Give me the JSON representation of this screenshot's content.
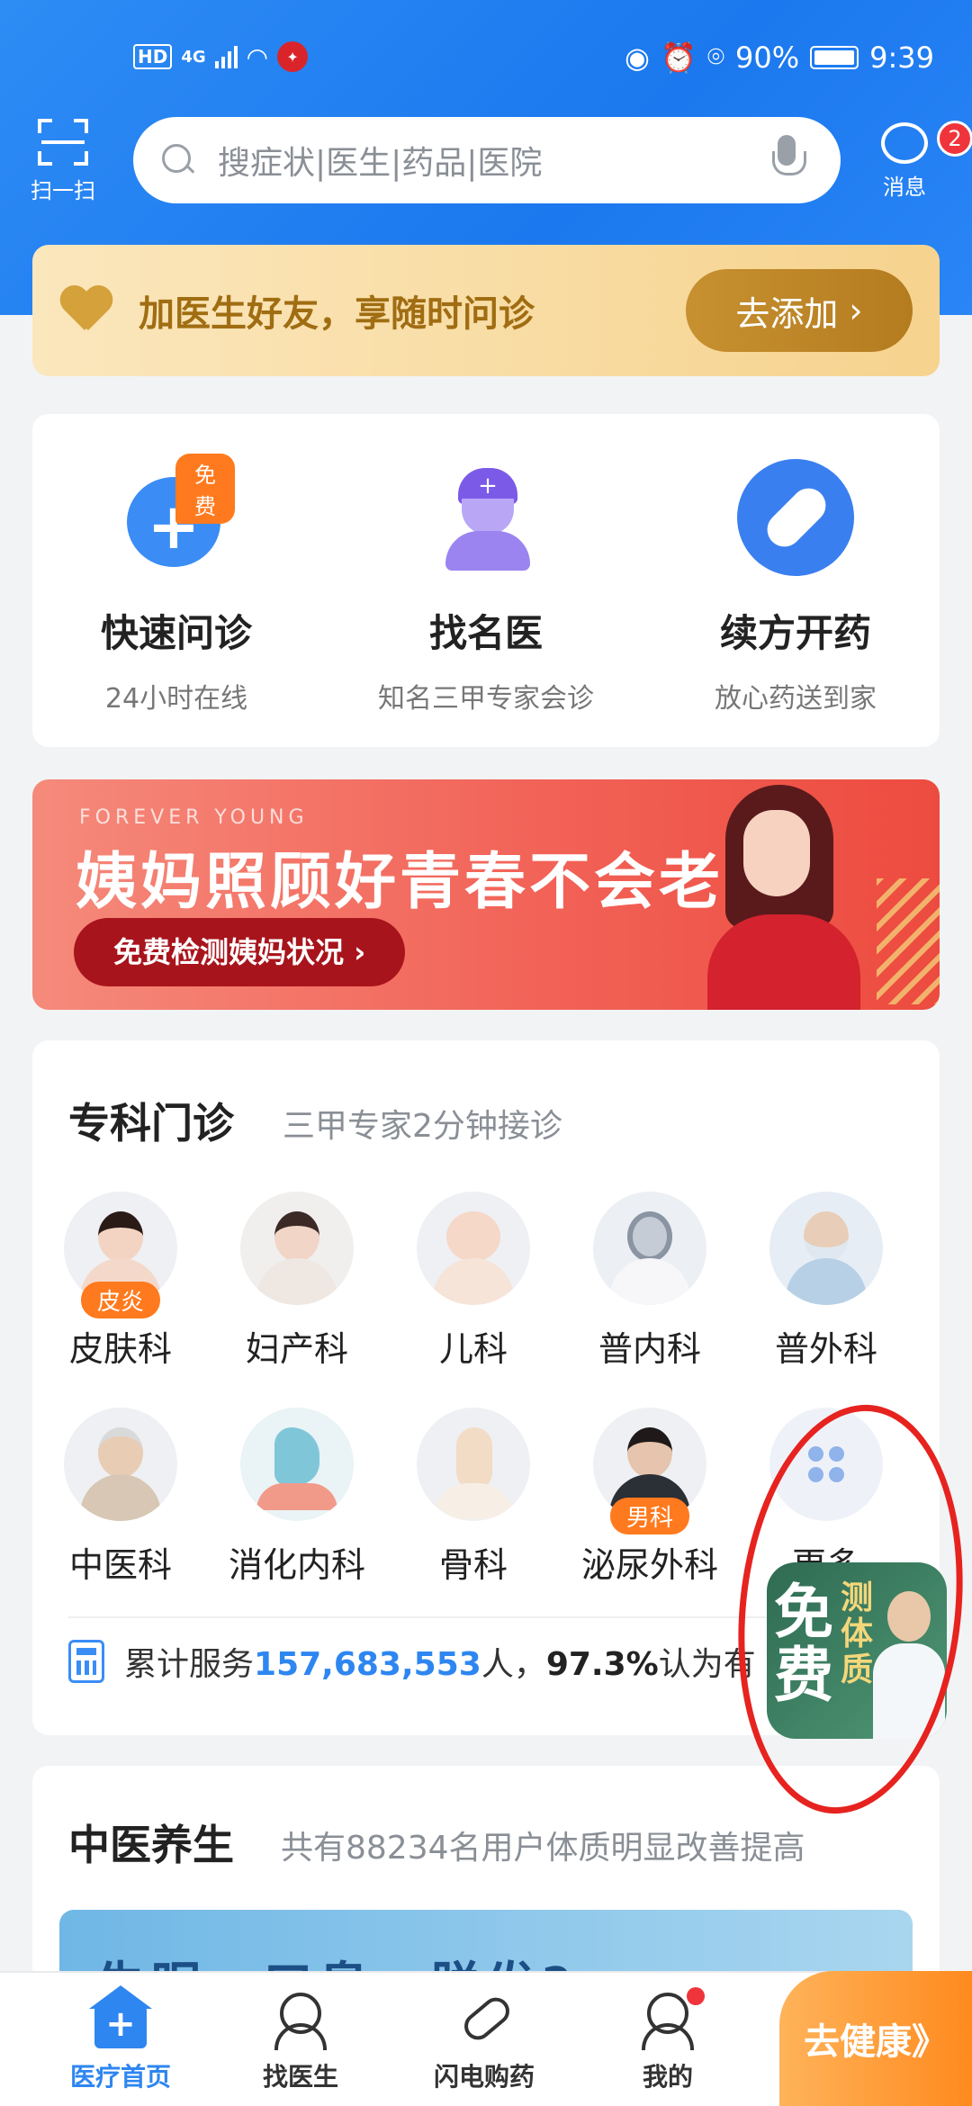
{
  "status_bar": {
    "hd": "HD",
    "network": "4G",
    "battery_pct": "90%",
    "time": "9:39"
  },
  "top_bar": {
    "scan_label": "扫一扫",
    "search_placeholder": "搜症状|医生|药品|医院",
    "messages_label": "消息",
    "messages_count": "2"
  },
  "friend_banner": {
    "text": "加医生好友，享随时问诊",
    "button": "去添加",
    "chevron": "›"
  },
  "quick_services": [
    {
      "icon": "consult-icon",
      "title": "快速问诊",
      "subtitle": "24小时在线",
      "badge": "免费"
    },
    {
      "icon": "doctor-icon",
      "title": "找名医",
      "subtitle": "知名三甲专家会诊"
    },
    {
      "icon": "pill-icon",
      "title": "续方开药",
      "subtitle": "放心药送到家"
    }
  ],
  "promo": {
    "en": "FOREVER YOUNG",
    "title": "姨妈照顾好青春不会老",
    "button": "免费检测姨妈状况 ›"
  },
  "specialty": {
    "title": "专科门诊",
    "subtitle": "三甲专家2分钟接诊",
    "departments": [
      {
        "label": "皮肤科",
        "tag": "皮炎"
      },
      {
        "label": "妇产科"
      },
      {
        "label": "儿科"
      },
      {
        "label": "普内科"
      },
      {
        "label": "普外科"
      },
      {
        "label": "中医科"
      },
      {
        "label": "消化内科"
      },
      {
        "label": "骨科"
      },
      {
        "label": "泌尿外科",
        "tag": "男科"
      },
      {
        "label": "更多"
      }
    ],
    "stats": {
      "prefix": "累计服务",
      "count": "157,683,553",
      "unit": "人，",
      "pct": "97.3%",
      "suffix": "认为有"
    }
  },
  "tcm": {
    "title": "中医养生",
    "subtitle": "共有88234名用户体质明显改善提高",
    "banner_text": "失眠、口臭、脱发?"
  },
  "floating_badge": {
    "free": "免费",
    "test": "测体质"
  },
  "bottom_nav": [
    {
      "label": "医疗首页",
      "icon": "home-icon",
      "active": true
    },
    {
      "label": "找医生",
      "icon": "doctor-icon"
    },
    {
      "label": "闪电购药",
      "icon": "pill-icon"
    },
    {
      "label": "我的",
      "icon": "profile-icon",
      "dot": true
    }
  ],
  "go_health": "去健康》",
  "colors": {
    "primary_blue": "#2e86f0",
    "gold": "#b47c1f",
    "orange_tag": "#ff7a1e",
    "promo_red": "#f26358",
    "annotation_red": "#e6231f"
  }
}
